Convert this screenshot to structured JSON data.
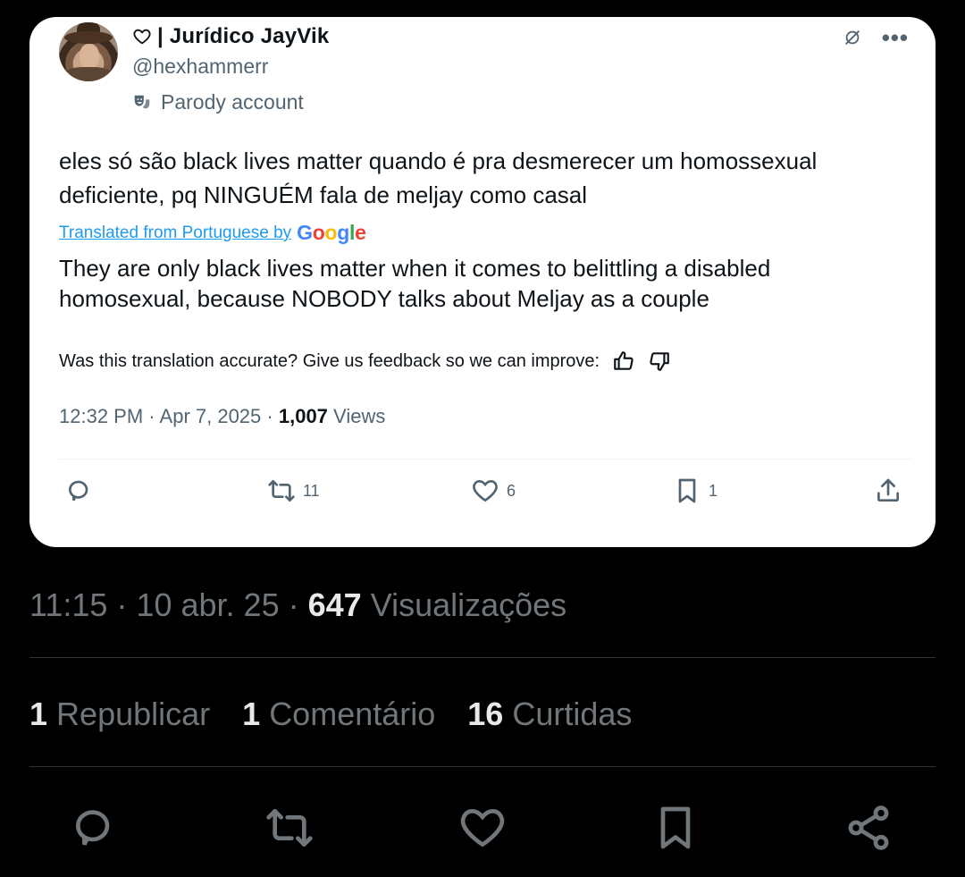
{
  "card": {
    "display_name": "| Jurídico JayVik",
    "handle": "@hexhammerr",
    "parody_label": "Parody account",
    "tweet_text": "eles só são black lives matter quando é pra desmerecer um homossexual deficiente, pq NINGUÉM fala de meljay como casal",
    "translated_link": "Translated from Portuguese by",
    "translator_brand": [
      "G",
      "o",
      "o",
      "g",
      "l",
      "e"
    ],
    "translation": "They are only black lives matter when it comes to belittling a disabled homosexual, because NOBODY talks about Meljay as a couple",
    "feedback_text": "Was this translation accurate? Give us feedback so we can improve:",
    "time": "12:32 PM",
    "date": "Apr 7, 2025",
    "views_count": "1,007",
    "views_label": "Views",
    "separator": "·",
    "actions": {
      "reply_count": "",
      "repost_count": "11",
      "like_count": "6",
      "bookmark_count": "1"
    },
    "more_glyph": "•••"
  },
  "outer": {
    "time": "11:15",
    "date": "10 abr. 25",
    "views_count": "647",
    "views_label": "Visualizações",
    "separator": "·",
    "stats": [
      {
        "count": "1",
        "label": "Republicar"
      },
      {
        "count": "1",
        "label": "Comentário"
      },
      {
        "count": "16",
        "label": "Curtidas"
      }
    ]
  },
  "colors": {
    "page_background": "#000000",
    "card_background": "#ffffff",
    "link_blue": "#1d9bf0",
    "muted_gray": "#71767b",
    "card_muted": "#536471"
  }
}
